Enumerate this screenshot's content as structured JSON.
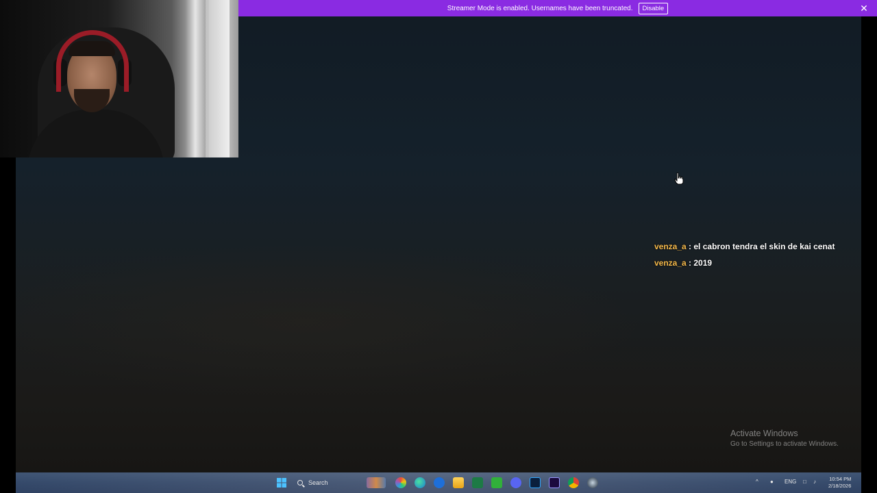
{
  "banner": {
    "message": "Streamer Mode is enabled. Usernames have been truncated.",
    "disable_label": "Disable",
    "close_glyph": "✕",
    "color": "#8a2be2"
  },
  "chat": {
    "messages": [
      {
        "user": "venza_a",
        "text": ": el cabron tendra el skin de kai cenat"
      },
      {
        "user": "venza_a",
        "text": ": 2019"
      }
    ],
    "user_color": "#f5b94a"
  },
  "watermark": {
    "title": "Activate Windows",
    "subtitle": "Go to Settings to activate Windows."
  },
  "taskbar": {
    "search_label": "Search",
    "apps": [
      "windows-start-icon",
      "game-thumbnail-icon",
      "paint-icon",
      "edge-icon",
      "app-blue-icon",
      "file-explorer-icon",
      "excel-icon",
      "xbox-icon",
      "discord-icon",
      "photoshop-icon",
      "premiere-icon",
      "chrome-icon",
      "steam-icon"
    ],
    "tray": {
      "language": "ENG"
    },
    "clock": {
      "time": "10:54 PM",
      "date": "2/18/2026"
    }
  }
}
